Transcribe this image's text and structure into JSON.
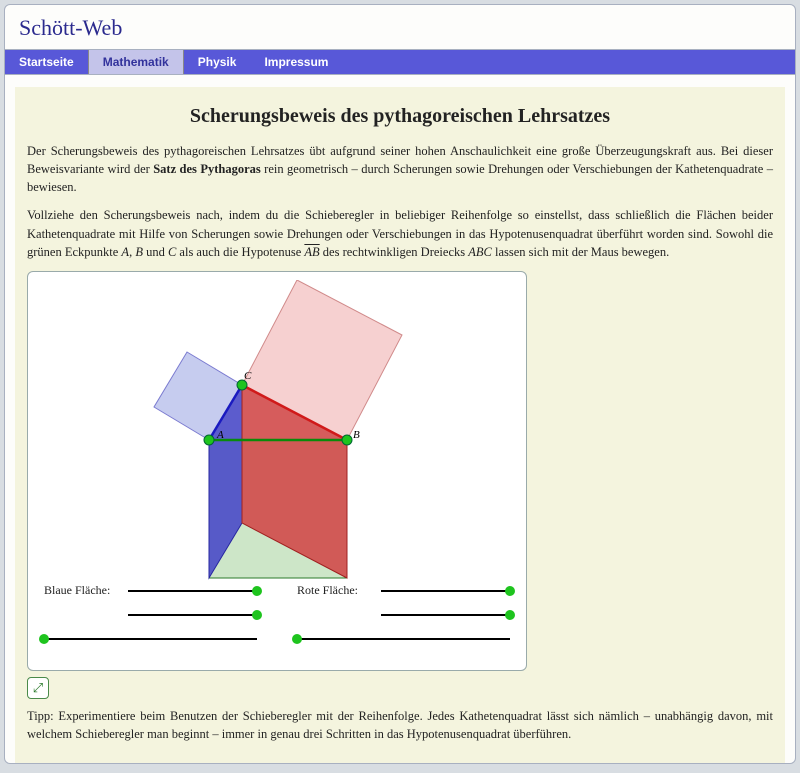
{
  "site": {
    "title": "Schött-Web"
  },
  "nav": {
    "items": [
      {
        "label": "Startseite"
      },
      {
        "label": "Mathematik"
      },
      {
        "label": "Physik"
      },
      {
        "label": "Impressum"
      }
    ],
    "activeIndex": 1
  },
  "page": {
    "title": "Scherungsbeweis des pythagoreischen Lehrsatzes",
    "p1a": "Der Scherungsbeweis des pythagoreischen Lehrsatzes übt aufgrund seiner hohen Anschaulichkeit eine große Überzeugungskraft aus. Bei dieser Beweisvariante wird der ",
    "p1b": "Satz des Pythagoras",
    "p1c": " rein geometrisch – durch Scherungen sowie Drehungen oder Verschiebungen der Kathetenquadrate – bewiesen.",
    "p2a": "Vollziehe den Scherungsbeweis nach, indem du die Schieberegler in beliebiger Reihenfolge so einstellst, dass schließlich die Flächen beider Kathetenquadrate mit Hilfe von Scherungen sowie Drehungen oder Verschiebungen in das Hypotenusenquadrat überführt worden sind. Sowohl die grünen Eckpunkte ",
    "p2pA": "A",
    "p2c1": ", ",
    "p2pB": "B",
    "p2c2": " und ",
    "p2pC": "C",
    "p2c3": " als auch die Hypotenuse ",
    "p2ab": "AB",
    "p2d": " des rechtwinkligen Dreiecks ",
    "p2abc": "ABC",
    "p2e": " lassen sich mit der Maus bewegen.",
    "tip": "Tipp: Experimentiere beim Benutzen der Schieberegler mit der Reihenfolge. Jedes Kathetenquadrat lässt sich nämlich – unabhängig davon, mit welchem Schieberegler man beginnt – immer in genau drei Schritten in das Hypotenusenquadrat überführen."
  },
  "applet": {
    "points": {
      "A": "A",
      "B": "B",
      "C": "C"
    },
    "blueLabel": "Blaue Fläche:",
    "redLabel": "Rote Fläche:"
  }
}
